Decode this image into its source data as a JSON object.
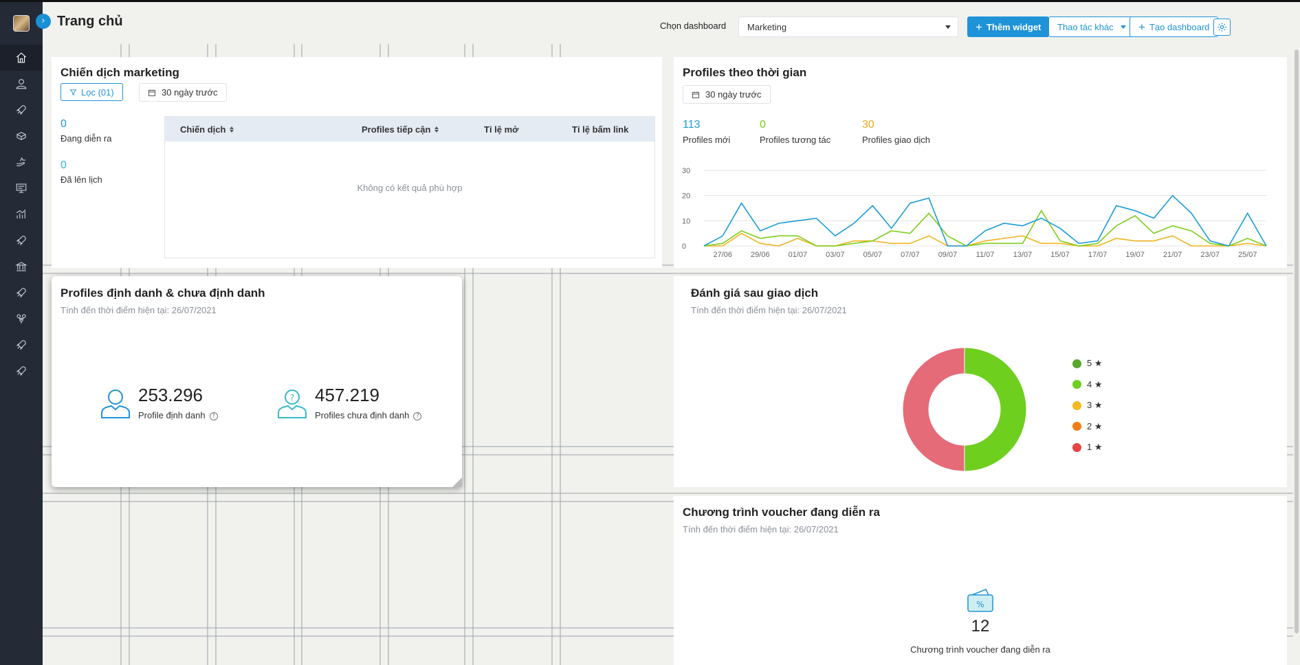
{
  "header": {
    "title": "Trang chủ",
    "dashboard_label": "Chọn dashboard",
    "dashboard_value": "Marketing",
    "add_widget": "Thêm widget",
    "more_actions": "Thao tác khác",
    "create_dashboard": "Tạo dashboard"
  },
  "sidebar": {
    "items": [
      {
        "icon": "home-icon"
      },
      {
        "icon": "user-icon"
      },
      {
        "icon": "rocket-icon"
      },
      {
        "icon": "gift-icon"
      },
      {
        "icon": "hand-icon"
      },
      {
        "icon": "monitor-icon"
      },
      {
        "icon": "chart-icon"
      },
      {
        "icon": "rocket-icon"
      },
      {
        "icon": "bank-icon"
      },
      {
        "icon": "rocket-icon"
      },
      {
        "icon": "team-icon"
      },
      {
        "icon": "rocket-icon"
      },
      {
        "icon": "rocket-icon"
      }
    ]
  },
  "campaign": {
    "title": "Chiến dịch marketing",
    "filter": "Lọc (01)",
    "date_range": "30 ngày trước",
    "running_count": "0",
    "running_label": "Đang diễn ra",
    "scheduled_count": "0",
    "scheduled_label": "Đã lên lịch",
    "columns": [
      "Chiến dịch",
      "Profiles tiếp cận",
      "Tỉ lệ mở",
      "Tỉ lệ bấm link"
    ],
    "empty": "Không có kết quả phù hợp"
  },
  "profiles_time": {
    "title": "Profiles theo thời gian",
    "date_range": "30 ngày trước",
    "new_count": "113",
    "new_label": "Profiles mới",
    "interact_count": "0",
    "interact_label": "Profiles tương tác",
    "trans_count": "30",
    "trans_label": "Profiles giao dịch"
  },
  "chart_data": [
    {
      "type": "line",
      "x": [
        "26/06",
        "27/06",
        "28/06",
        "29/06",
        "30/06",
        "01/07",
        "02/07",
        "03/07",
        "04/07",
        "05/07",
        "06/07",
        "07/07",
        "08/07",
        "09/07",
        "10/07",
        "11/07",
        "12/07",
        "13/07",
        "14/07",
        "15/07",
        "16/07",
        "17/07",
        "18/07",
        "19/07",
        "20/07",
        "21/07",
        "22/07",
        "23/07",
        "24/07",
        "25/07",
        "26/07"
      ],
      "tick_labels": [
        "27/06",
        "29/06",
        "01/07",
        "03/07",
        "05/07",
        "07/07",
        "09/07",
        "11/07",
        "13/07",
        "15/07",
        "17/07",
        "19/07",
        "21/07",
        "23/07",
        "25/07"
      ],
      "yticks": [
        0,
        10,
        20,
        30
      ],
      "ylim": [
        0,
        30
      ],
      "colors": [
        "#1a9bd7",
        "#7ccd1c",
        "#f0b31e"
      ],
      "series": [
        {
          "values": [
            0,
            4,
            17,
            6,
            9,
            10,
            11,
            4,
            9,
            16,
            7,
            17,
            19,
            0,
            0,
            6,
            9,
            8,
            11,
            7,
            1,
            2,
            16,
            14,
            11,
            20,
            13,
            2,
            0,
            13,
            0
          ]
        },
        {
          "values": [
            0,
            1,
            6,
            3,
            4,
            4,
            0,
            0,
            1,
            2,
            6,
            5,
            13,
            4,
            0,
            1,
            1,
            1,
            14,
            2,
            0,
            1,
            8,
            12,
            5,
            8,
            6,
            1,
            0,
            3,
            0
          ]
        },
        {
          "values": [
            0,
            0,
            5,
            1,
            0,
            3,
            0,
            0,
            2,
            2,
            1,
            1,
            4,
            0,
            0,
            2,
            3,
            4,
            1,
            1,
            0,
            0,
            3,
            2,
            2,
            4,
            0,
            0,
            0,
            1,
            0
          ]
        }
      ]
    },
    {
      "type": "pie",
      "title": "Đánh giá sau giao dịch",
      "labels": [
        "5 ★",
        "4 ★",
        "3 ★",
        "2 ★",
        "1 ★"
      ],
      "values": [
        0,
        50,
        0,
        0,
        50
      ],
      "colors": [
        "#58a52b",
        "#6ecf1f",
        "#f2b921",
        "#ef7d15",
        "#ea4444"
      ],
      "ring_colors": {
        "4 ★": "#6ecf1f",
        "1 ★": "#e56b78"
      }
    }
  ],
  "identity": {
    "title": "Profiles định danh & chưa định danh",
    "subtitle": "Tính đến thời điểm hiện tại: 26/07/2021",
    "identified_count": "253.296",
    "identified_label": "Profile định danh",
    "unidentified_count": "457.219",
    "unidentified_label": "Profiles chưa định danh"
  },
  "rating": {
    "title": "Đánh giá sau giao dịch",
    "subtitle": "Tính đến thời điểm hiện tại: 26/07/2021"
  },
  "voucher": {
    "title": "Chương trình voucher đang diễn ra",
    "subtitle": "Tính đến thời điểm hiện tại: 26/07/2021",
    "count": "12",
    "label": "Chương trình voucher đang diễn ra"
  }
}
